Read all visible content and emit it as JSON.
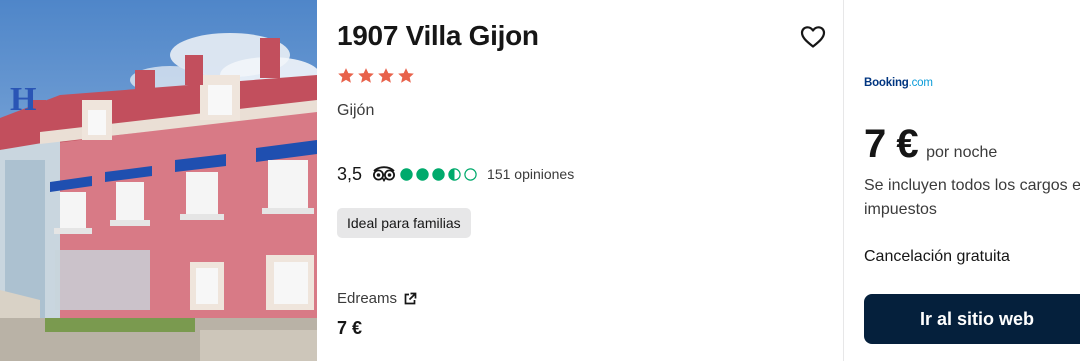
{
  "hotel": {
    "name": "1907 Villa Gijon",
    "stars": 4,
    "location": "Gijón",
    "rating": {
      "score": "3,5",
      "bubbles": 3.5,
      "reviews": "151 opiniones"
    },
    "tag": "Ideal para familias"
  },
  "provider": {
    "name": "Edreams",
    "price": "7 €"
  },
  "deal": {
    "partner_main": "Booking",
    "partner_suffix": ".com",
    "price": "7 €",
    "per_night": "por noche",
    "taxes": "Se incluyen todos los cargos e impuestos",
    "cancellation": "Cancelación gratuita",
    "cta": "Ir al sitio web"
  },
  "colors": {
    "star": "#e8624b",
    "bubble": "#00aa6c",
    "cta_bg": "#05203c",
    "booking_blue": "#003580",
    "booking_light": "#0a9bd8"
  },
  "icons": {
    "favorite": "heart-outline-icon",
    "tripadvisor": "tripadvisor-owl-icon",
    "external": "external-link-icon"
  }
}
